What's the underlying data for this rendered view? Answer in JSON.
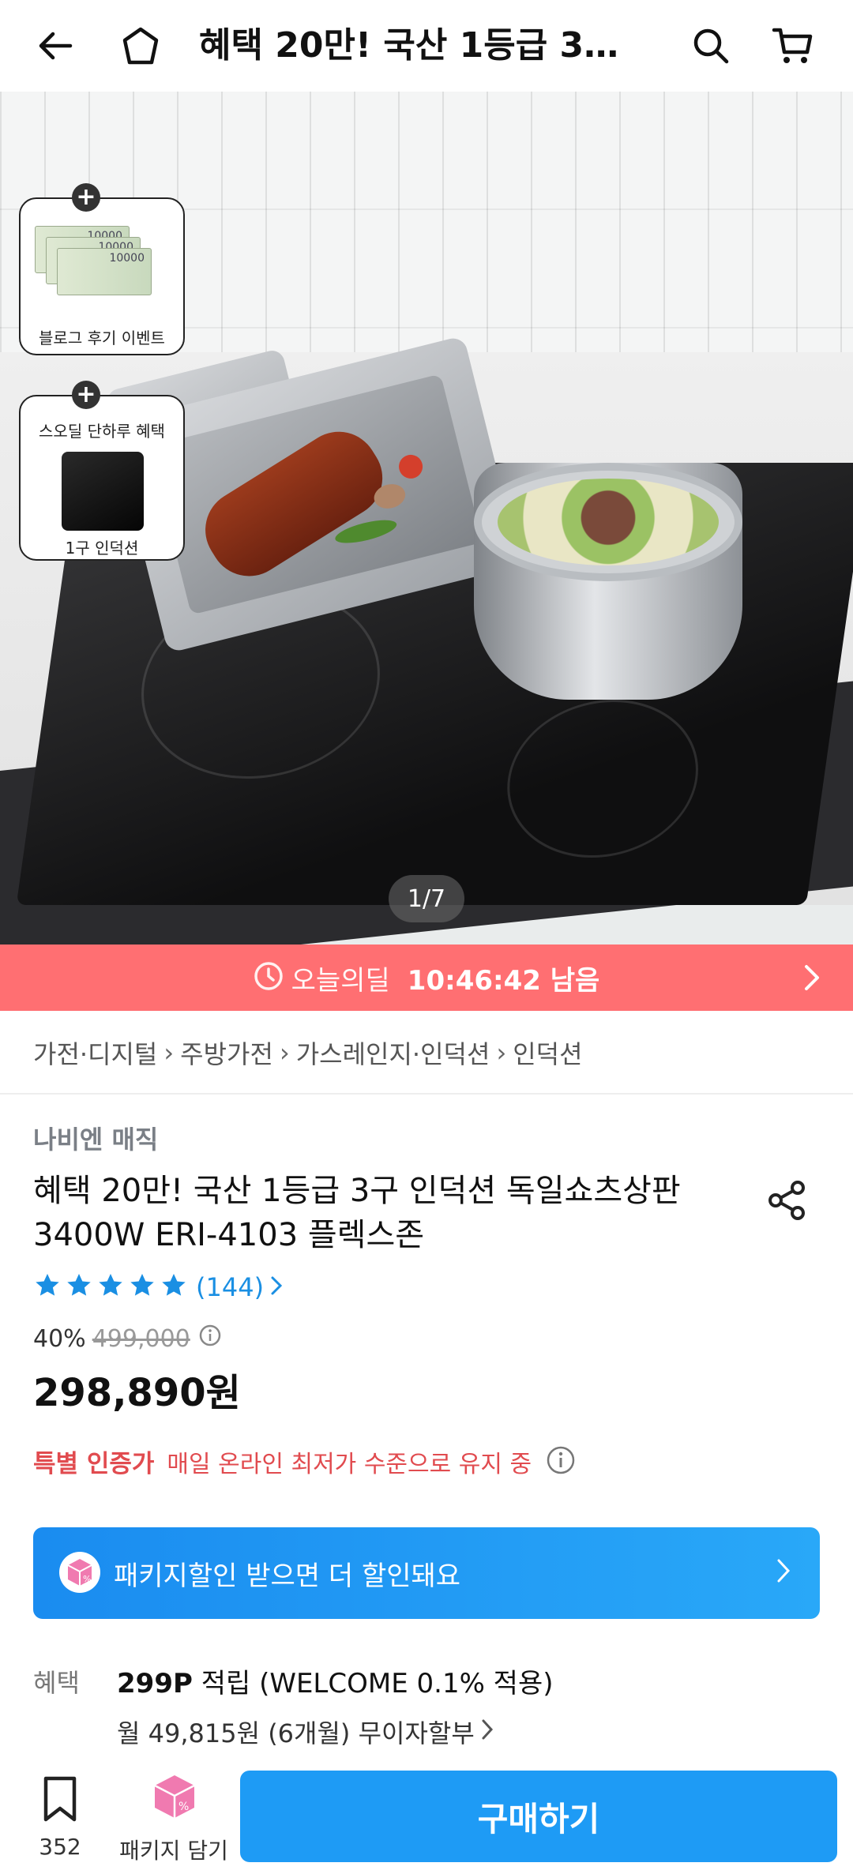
{
  "header": {
    "title": "혜택 20만! 국산 1등급 3구 인덕션 독일쇼츠상판 3400W ERI-4103 플렉스존",
    "icons": [
      "back-arrow-icon",
      "home-icon",
      "search-icon",
      "cart-icon"
    ]
  },
  "hero": {
    "page_indicator": "1/7",
    "promo_card_1": {
      "label": "블로그 후기 이벤트",
      "bill_values": [
        "10000",
        "10000",
        "10000"
      ]
    },
    "promo_card_2": {
      "top_label": "스오딜 단하루 혜택",
      "bottom_label": "1구 인덕션"
    }
  },
  "deal": {
    "label": "오늘의딜",
    "time_left": "10:46:42 남음"
  },
  "breadcrumb": {
    "items": [
      "가전·디지털",
      "주방가전",
      "가스레인지·인덕션",
      "인덕션"
    ]
  },
  "product": {
    "brand": "나비엔 매직",
    "title": "혜택 20만! 국산 1등급 3구 인덕션 독일쇼츠상판 3400W ERI-4103 플렉스존",
    "rating_stars": 5,
    "review_count": "(144)",
    "discount_percent": "40%",
    "original_price": "499,000",
    "price": "298,890원",
    "special_label": "특별 인증가",
    "special_desc": "매일 온라인 최저가 수준으로 유지 중"
  },
  "package_banner": {
    "text": "패키지할인 받으면 더 할인돼요"
  },
  "benefits": {
    "label": "혜택",
    "points": "299P",
    "points_rest": " 적립 (WELCOME 0.1% 적용)",
    "installment": "월 49,815원 (6개월) 무이자할부"
  },
  "bottom_bar": {
    "bookmark_count": "352",
    "package_label": "패키지 담기",
    "buy_label": "구매하기"
  },
  "colors": {
    "deal_bar": "#ff6f72",
    "accent_blue": "#1e9bf5",
    "star_blue": "#1a8fe3",
    "special_red": "#e14b4f"
  }
}
